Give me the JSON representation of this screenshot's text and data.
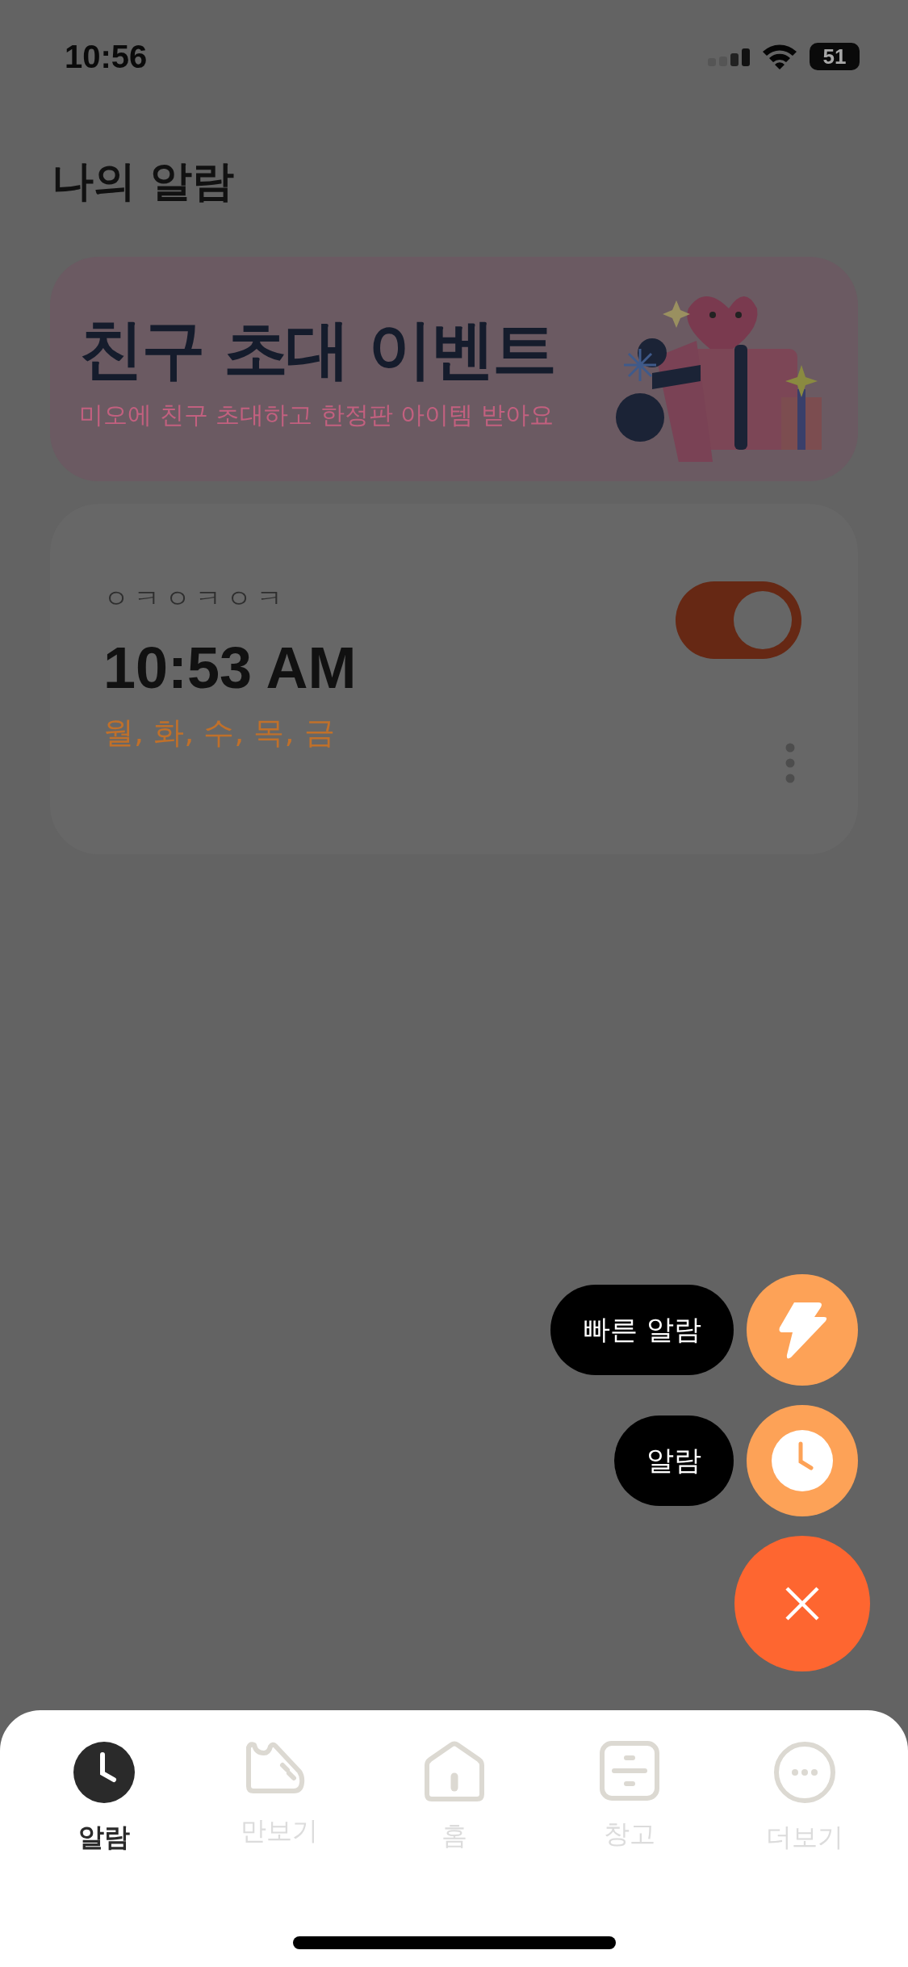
{
  "status_bar": {
    "time": "10:56",
    "battery": "51"
  },
  "page_title": "나의 알람",
  "banner": {
    "title": "친구 초대 이벤트",
    "subtitle": "미오에 친구 초대하고 한정판 아이템 받아요"
  },
  "alarms": [
    {
      "label": "ㅇㅋㅇㅋㅇㅋ",
      "time": "10:53 AM",
      "days": "월, 화, 수, 목, 금",
      "on": true
    }
  ],
  "fab_menu": {
    "open": true,
    "actions": [
      {
        "kind": "quick",
        "label": "빠른 알람"
      },
      {
        "kind": "alarm",
        "label": "알람"
      }
    ]
  },
  "tabs": [
    {
      "kind": "alarm",
      "label": "알람",
      "selected": true
    },
    {
      "kind": "pedometer",
      "label": "만보기",
      "selected": false
    },
    {
      "kind": "home",
      "label": "홈",
      "selected": false
    },
    {
      "kind": "storage",
      "label": "창고",
      "selected": false
    },
    {
      "kind": "more",
      "label": "더보기",
      "selected": false
    }
  ]
}
